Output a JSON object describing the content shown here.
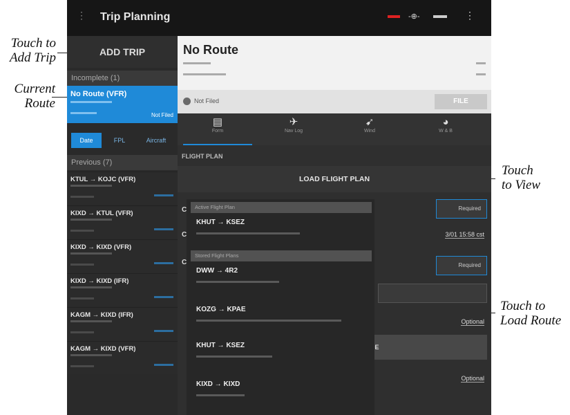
{
  "callouts": {
    "add_trip": [
      "Touch to",
      "Add Trip"
    ],
    "current_route": [
      "Current",
      "Route"
    ],
    "view": [
      "Touch",
      "to View"
    ],
    "load_route": [
      "Touch to",
      "Load Route"
    ]
  },
  "app": {
    "title": "Trip Planning",
    "topbar_icons": [
      "menu-icon",
      "red-indicator-icon",
      "airport-icon",
      "overflow-menu-icon"
    ]
  },
  "sidebar": {
    "add_trip_label": "ADD TRIP",
    "incomplete_heading": "Incomplete (1)",
    "current_route": {
      "title": "No Route (VFR)",
      "status": "Not Filed"
    },
    "tabs": [
      "Date",
      "FPL",
      "Aircraft"
    ],
    "previous_heading": "Previous (7)",
    "previous_items": [
      {
        "title": "KTUL → KOJC (VFR)"
      },
      {
        "title": "KIXD → KTUL (VFR)"
      },
      {
        "title": "KIXD → KIXD (VFR)"
      },
      {
        "title": "KIXD → KIXD (IFR)"
      },
      {
        "title": "KAGM → KIXD (IFR)"
      },
      {
        "title": "KAGM → KIXD (VFR)"
      }
    ]
  },
  "main": {
    "route_title": "No Route",
    "filed_status": "Not Filed",
    "file_button": "FILE",
    "tabs": [
      {
        "icon": "flight-plan-icon",
        "label": "Form"
      },
      {
        "icon": "nav-log-icon",
        "label": "Nav Log"
      },
      {
        "icon": "wind-icon",
        "label": "Wind"
      },
      {
        "icon": "weight-balance-icon",
        "label": "W & B"
      }
    ],
    "flight_plan_heading": "FLIGHT PLAN",
    "load_flight_plan": "LOAD FLIGHT PLAN",
    "bg_link_time": "3/01 15:58 cst",
    "bg_box_label": "ASIDE",
    "bg_links": [
      "Optional",
      "Optional"
    ]
  },
  "dropdown": {
    "active_heading": "Active Flight Plan",
    "stored_heading": "Stored Flight Plans",
    "items": [
      {
        "title": "KHUT → KSEZ"
      },
      {
        "title": "DWW → 4R2"
      },
      {
        "title": "KOZG → KPAE"
      },
      {
        "title": "KHUT → KSEZ"
      },
      {
        "title": "KIXD → KIXD"
      }
    ]
  },
  "colors": {
    "accent": "#1f8ad8",
    "app_bg": "#2e2e2e",
    "topbar": "#161616"
  }
}
